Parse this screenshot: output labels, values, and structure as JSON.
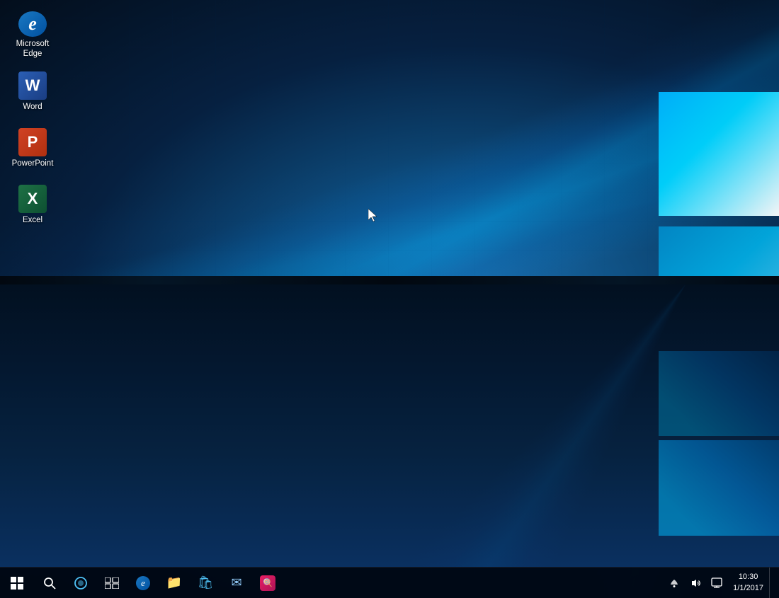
{
  "desktop": {
    "background_color": "#0a1e35"
  },
  "desktop_icons": [
    {
      "id": "microsoft-edge",
      "label": "Microsoft\nEdge",
      "label_line1": "Microsoft",
      "label_line2": "Edge",
      "icon_type": "edge",
      "position": 0
    },
    {
      "id": "word",
      "label": "Word",
      "label_line1": "Word",
      "label_line2": "",
      "icon_type": "word",
      "position": 1
    },
    {
      "id": "powerpoint",
      "label": "PowerPoint",
      "label_line1": "PowerPoint",
      "label_line2": "",
      "icon_type": "powerpoint",
      "position": 2
    },
    {
      "id": "excel",
      "label": "Excel",
      "label_line1": "Excel",
      "label_line2": "",
      "icon_type": "excel",
      "position": 3
    }
  ],
  "taskbar": {
    "items": [
      {
        "id": "start",
        "label": "Start",
        "type": "start"
      },
      {
        "id": "search",
        "label": "Search",
        "type": "search"
      },
      {
        "id": "cortana",
        "label": "Cortana",
        "type": "cortana"
      },
      {
        "id": "task-view",
        "label": "Task View",
        "type": "task-view"
      },
      {
        "id": "edge",
        "label": "Microsoft Edge",
        "type": "pinned-edge"
      },
      {
        "id": "file-explorer",
        "label": "File Explorer",
        "type": "pinned-folder"
      },
      {
        "id": "store",
        "label": "Store",
        "type": "pinned-store"
      },
      {
        "id": "mail",
        "label": "Mail",
        "type": "pinned-mail"
      },
      {
        "id": "app1",
        "label": "App",
        "type": "pinned-app"
      }
    ],
    "tray": {
      "time": "10:30",
      "date": "1/1/2017"
    }
  }
}
